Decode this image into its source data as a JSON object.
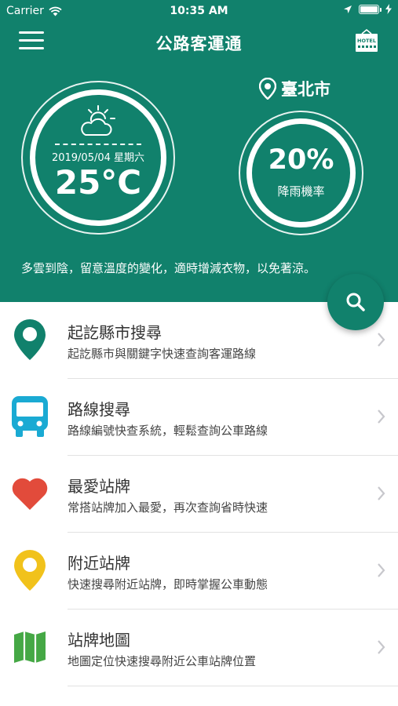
{
  "status_bar": {
    "carrier": "Carrier",
    "time": "10:35 AM"
  },
  "nav": {
    "title": "公路客運通",
    "hotel_icon_text": "HOTEL"
  },
  "weather": {
    "date": "2019/05/04 星期六",
    "temperature": "25°C",
    "icon": "partly-cloudy-icon",
    "city": "臺北市",
    "rain_value": "20%",
    "rain_label": "降雨機率",
    "advice": "多雲到陰，留意溫度的變化，適時增減衣物，以免著涼。"
  },
  "menu_items": [
    {
      "title": "起訖縣市搜尋",
      "desc": "起訖縣市與關鍵字快速查詢客運路線",
      "icon": "map-pin-icon",
      "color": "#11816c"
    },
    {
      "title": "路線搜尋",
      "desc": "路線編號快查系統，輕鬆查詢公車路線",
      "icon": "bus-icon",
      "color": "#1aaad3"
    },
    {
      "title": "最愛站牌",
      "desc": "常搭站牌加入最愛，再次查詢省時快速",
      "icon": "heart-icon",
      "color": "#e24b3b"
    },
    {
      "title": "附近站牌",
      "desc": "快速搜尋附近站牌，即時掌握公車動態",
      "icon": "location-pin-icon",
      "color": "#f1c21b"
    },
    {
      "title": "站牌地圖",
      "desc": "地圖定位快速搜尋附近公車站牌位置",
      "icon": "map-icon",
      "color": "#45a845"
    }
  ],
  "colors": {
    "header_bg": "#11816c"
  }
}
